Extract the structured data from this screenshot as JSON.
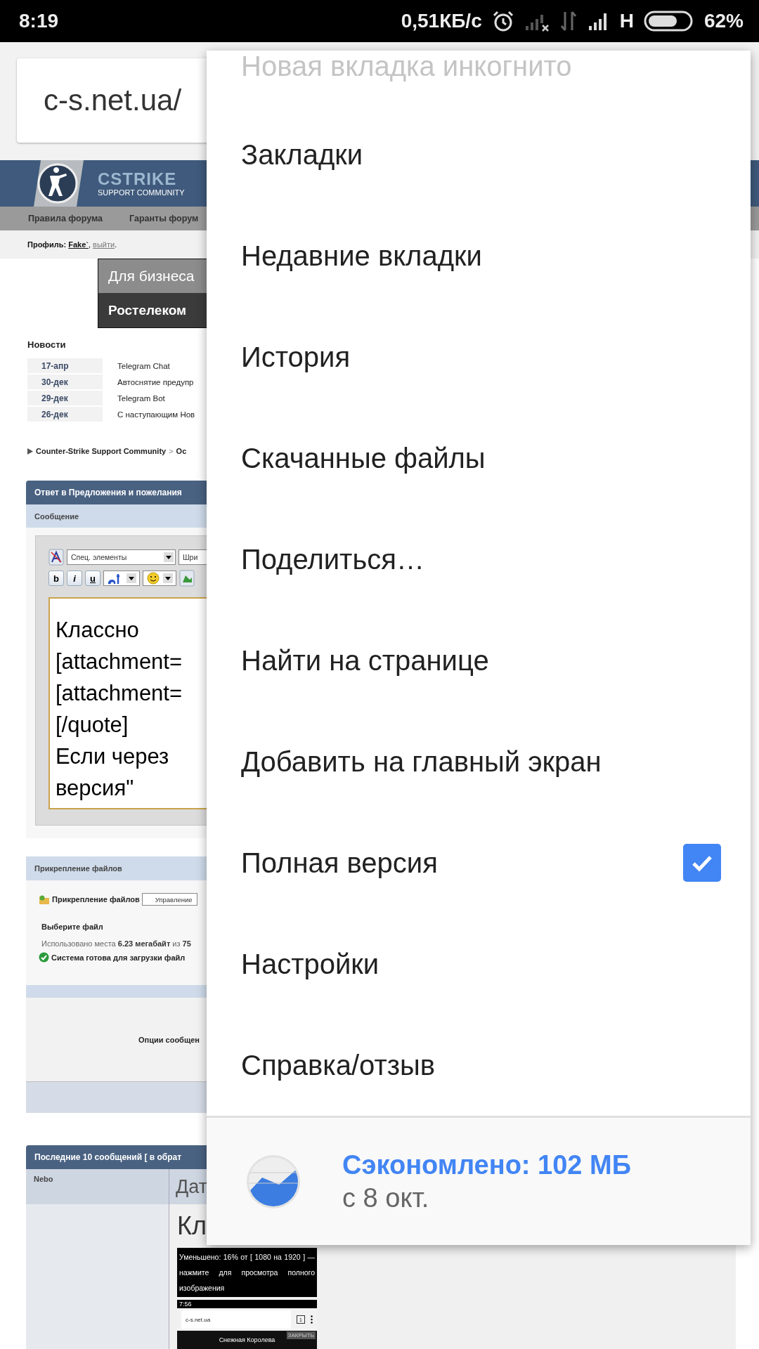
{
  "status_bar": {
    "time": "8:19",
    "speed": "0,51КБ/с",
    "network": "H",
    "battery": "62%"
  },
  "toolbar": {
    "url": "c-s.net.ua/"
  },
  "page": {
    "logo_title": "CSTRIKE",
    "logo_subtitle": "SUPPORT COMMUNITY",
    "nav": [
      "Правила форума",
      "Гаранты форум"
    ],
    "profile": {
      "label": "Профиль:",
      "user": "Fake`",
      "sep": ",",
      "logout": "выйти",
      "end": "."
    },
    "ad": {
      "line1": "Для бизнеса",
      "line2": "Ростелеком"
    },
    "news_title": "Новости",
    "news": [
      {
        "date": "17-апр",
        "title": "Telegram Chat"
      },
      {
        "date": "30-дек",
        "title": "Автоснятие предупр"
      },
      {
        "date": "29-дек",
        "title": "Telegram Bot"
      },
      {
        "date": "26-дек",
        "title": "С наступающим Нов"
      }
    ],
    "breadcrumb": {
      "root": "Counter-Strike Support Community",
      "sep": ">",
      "current": "Ос"
    },
    "reply": {
      "title": "Ответ в Предложения и пожелания",
      "section": "Сообщение",
      "special_select": "Спец. элементы",
      "font_select": "Шри",
      "format_buttons": [
        "b",
        "i",
        "u"
      ],
      "text_lines": [
        "Классно",
        "[attachment=",
        "[attachment=",
        "[/quote]",
        "Если через",
        "версия\""
      ]
    },
    "attachments": {
      "title": "Прикрепление файлов",
      "label": "Прикрепление файлов",
      "manage_button": "Управление",
      "choose": "Выберите файл",
      "usage": "Использовано места **6.23 мегабайт** из **75**",
      "status": "Система готова для загрузки файл"
    },
    "options": "Опции сообщен",
    "recent": {
      "title": "Последние 10 сообщений [ в обрат",
      "author": "Nebo",
      "date": "Дат",
      "text": "Кл",
      "image_note": "Уменьшено: 16% от [ 1080 на 1920 ] — нажмите для просмотра полного изображения",
      "thumb": {
        "time": "7:56",
        "url": "c-s.net.ua",
        "tabs": "1",
        "banner": "Снежная Королева",
        "close": "ЗАКРЫТЬ"
      }
    }
  },
  "menu": {
    "items": [
      {
        "label": "Новая вкладка инкогнито",
        "kind": "partial"
      },
      {
        "label": "Закладки",
        "kind": "item"
      },
      {
        "label": "Недавние вкладки",
        "kind": "item"
      },
      {
        "label": "История",
        "kind": "item"
      },
      {
        "label": "Скачанные файлы",
        "kind": "item"
      },
      {
        "label": "Поделиться…",
        "kind": "item"
      },
      {
        "label": "Найти на странице",
        "kind": "item"
      },
      {
        "label": "Добавить на главный экран",
        "kind": "item"
      },
      {
        "label": "Полная версия",
        "kind": "checkbox",
        "checked": true
      },
      {
        "label": "Настройки",
        "kind": "item"
      },
      {
        "label": "Справка/отзыв",
        "kind": "item"
      }
    ],
    "saver": {
      "title": "Сэкономлено: 102 МБ",
      "since": "с 8 окт."
    }
  }
}
